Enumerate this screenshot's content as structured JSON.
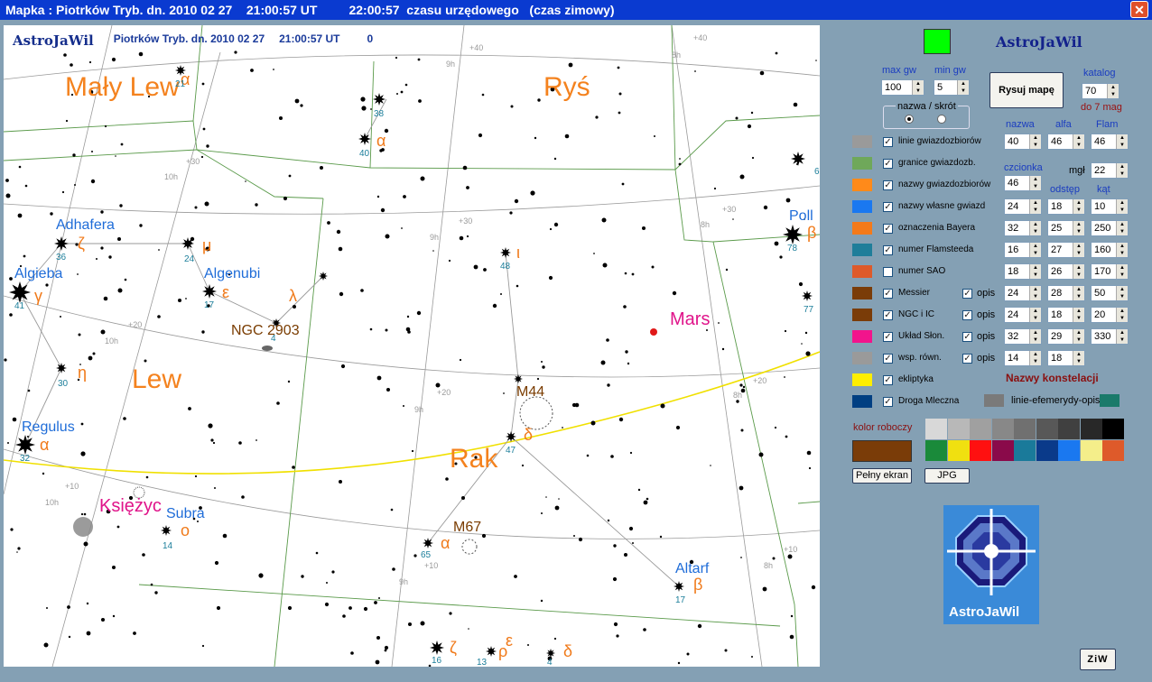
{
  "window": {
    "title": "Mapka : Piotrków Tryb. dn. 2010 02 27    21:00:57 UT         22:00:57  czasu urzędowego   (czas zimowy)",
    "close": "✕"
  },
  "map": {
    "brand": "AstroJaWil",
    "header_place": "Piotrków Tryb. dn. 2010 02 27",
    "header_time": "21:00:57 UT",
    "header_zero": "0",
    "constellations": [
      "Mały Lew",
      "Ryś",
      "Lew",
      "Rak"
    ],
    "stars": [
      "Adhafera",
      "Algieba",
      "Algenubi",
      "Regulus",
      "Subra",
      "Altarf",
      "Poll"
    ],
    "bayer": [
      "α",
      "ζ",
      "μ",
      "γ",
      "ε",
      "λ",
      "η",
      "α",
      "ο",
      "ι",
      "δ",
      "α",
      "β",
      "β",
      "ζ",
      "ρ",
      "ε",
      "δ"
    ],
    "flamsteed": [
      "21",
      "38",
      "40",
      "36",
      "24",
      "41",
      "17",
      "4",
      "30",
      "32",
      "14",
      "48",
      "47",
      "65",
      "17",
      "78",
      "77",
      "16",
      "13",
      "4",
      "6"
    ],
    "messier": [
      "NGC 2903",
      "M44",
      "M67"
    ],
    "planets": [
      "Mars",
      "Księżyc"
    ],
    "grid_labels": [
      "+40",
      "9h",
      "8h",
      "+40",
      "+30",
      "10h",
      "+30",
      "+30",
      "9h",
      "8h",
      "+20",
      "10h",
      "+20",
      "+20",
      "9h",
      "8h",
      "+10",
      "10h",
      "+10",
      "+10",
      "9h",
      "8h"
    ]
  },
  "panel": {
    "brand": "AstroJaWil",
    "max_gw_label": "max gw",
    "max_gw": "100",
    "min_gw_label": "min gw",
    "min_gw": "5",
    "draw_button": "Rysuj mapę",
    "catalog_label": "katalog",
    "catalog": "70",
    "catalog_note": "do 7 mag",
    "name_short_label": "nazwa / skrót",
    "col_nazwa": "nazwa",
    "col_alfa": "alfa",
    "col_flam": "Flam",
    "row1_values": [
      "40",
      "46",
      "46"
    ],
    "czcionka_label": "czcionka",
    "czcionka": "46",
    "mgl_label": "mgł",
    "mgl": "22",
    "odstep_label": "odstęp",
    "kat_label": "kąt",
    "opis": "opis",
    "layers": [
      {
        "label": "linie gwiazdozbiorów",
        "color": "#9a9a9a",
        "checked": true
      },
      {
        "label": "granice gwiazdozb.",
        "color": "#6fa85a",
        "checked": true
      },
      {
        "label": "nazwy gwiazdozbiorów",
        "color": "#ff8a1a",
        "checked": true
      },
      {
        "label": "nazwy własne gwiazd",
        "color": "#1a78f0",
        "checked": true
      },
      {
        "label": "oznaczenia Bayera",
        "color": "#f47a1a",
        "checked": true
      },
      {
        "label": "numer Flamsteeda",
        "color": "#1f7e9a",
        "checked": true
      },
      {
        "label": "numer SAO",
        "color": "#de5a2a",
        "checked": false
      },
      {
        "label": "Messier",
        "color": "#7a3c08",
        "checked": true
      },
      {
        "label": "NGC  i  IC",
        "color": "#7a3c08",
        "checked": true
      },
      {
        "label": "Układ Słon.",
        "color": "#f2148c",
        "checked": true
      },
      {
        "label": "wsp. równ.",
        "color": "#9a9a9a",
        "checked": true
      },
      {
        "label": "ekliptyka",
        "color": "#ffee00",
        "checked": true
      },
      {
        "label": "Droga Mleczna",
        "color": "#003f82",
        "checked": true
      }
    ],
    "layer_values": [
      [
        "24",
        "18",
        "10"
      ],
      [
        "32",
        "25",
        "250"
      ],
      [
        "16",
        "27",
        "160"
      ],
      [
        "18",
        "26",
        "170"
      ],
      [
        "24",
        "28",
        "50"
      ],
      [
        "24",
        "18",
        "20"
      ],
      [
        "32",
        "29",
        "330"
      ],
      [
        "14",
        "18",
        ""
      ]
    ],
    "const_names_label": "Nazwy konstelacji",
    "ephem_label": "linie-efemerydy-opis",
    "work_color_label": "kolor roboczy",
    "work_color": "#7a3c08",
    "palette": [
      "#d8d8d8",
      "#b8b8b8",
      "#a0a0a0",
      "#888888",
      "#707070",
      "#585858",
      "#404040",
      "#282828",
      "#000000",
      "#1a8a3a",
      "#f0e010",
      "#ff1010",
      "#8a0a4a",
      "#1a7a9a",
      "#0a3a8a",
      "#1a78f0",
      "#f4ee8a",
      "#de5a2a"
    ],
    "fullscreen_button": "Pełny ekran",
    "jpg_button": "JPG",
    "logo_text": "AstroJaWil",
    "ziw_button": "ZiW"
  }
}
